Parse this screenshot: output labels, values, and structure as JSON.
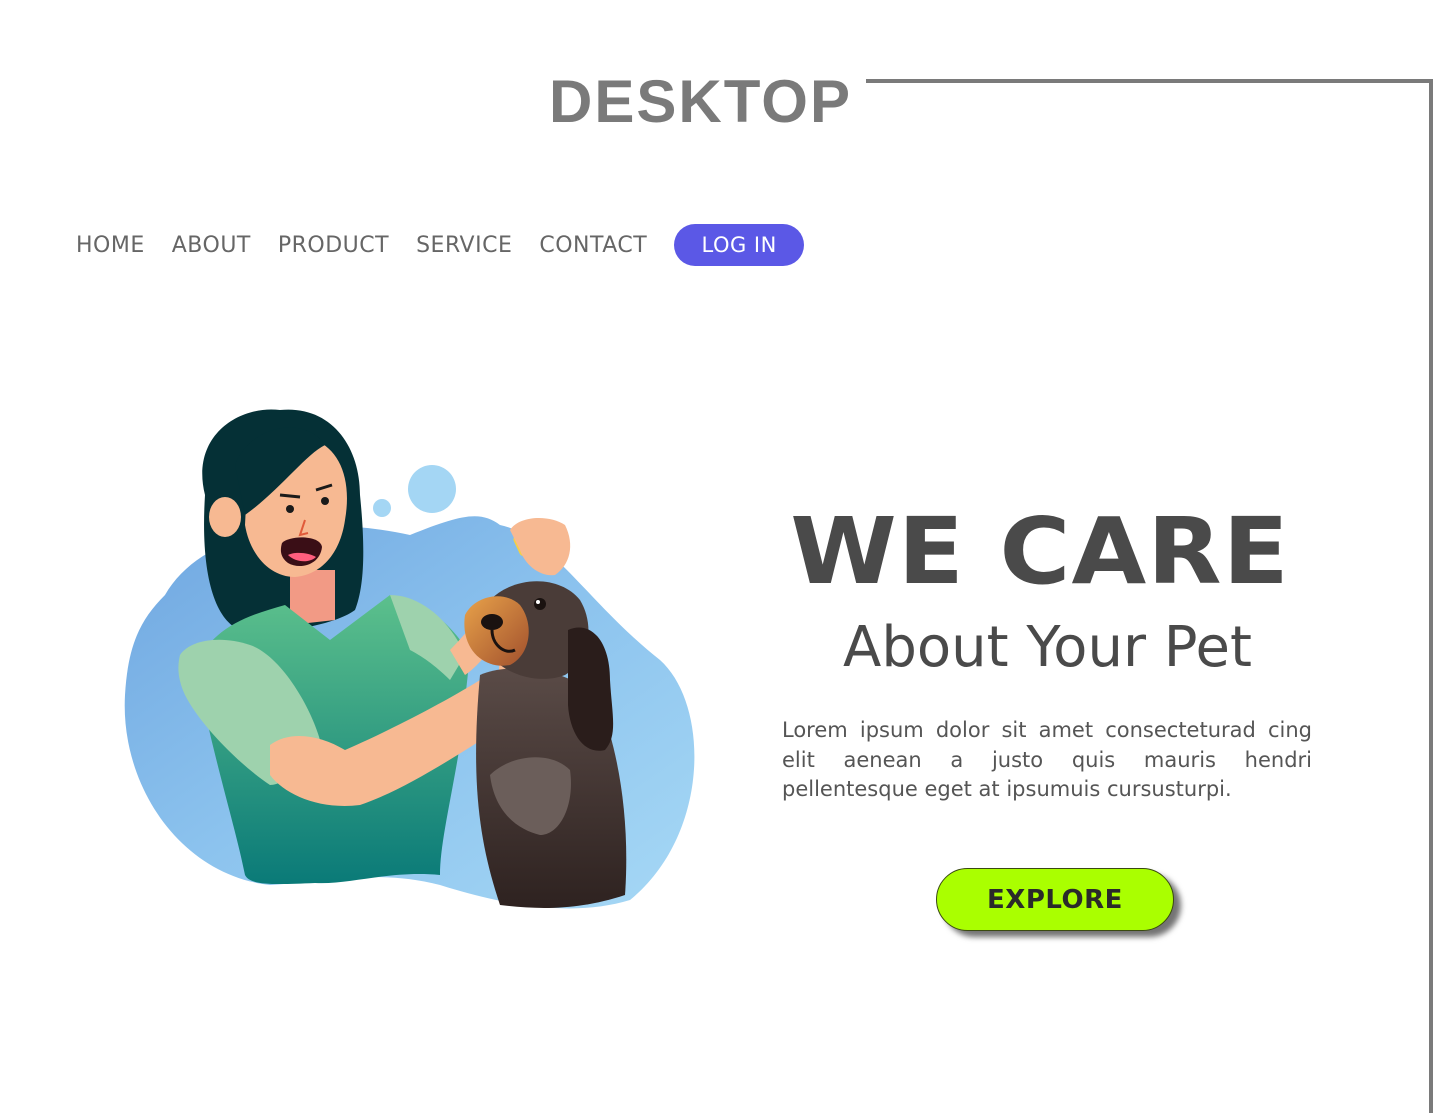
{
  "page_label": "DESKTOP",
  "nav": {
    "items": [
      {
        "label": "HOME"
      },
      {
        "label": "ABOUT"
      },
      {
        "label": "PRODUCT"
      },
      {
        "label": "SERVICE"
      },
      {
        "label": "CONTACT"
      }
    ],
    "login_label": "LOG IN"
  },
  "hero": {
    "title": "WE CARE",
    "subtitle": "About Your Pet",
    "body": "Lorem ipsum dolor sit amet consecteturad cing elit aenean a justo quis mauris hendri pellentesque eget at ipsumuis cursusturpi.",
    "cta_label": "EXPLORE"
  },
  "colors": {
    "accent_login": "#5b58e6",
    "cta": "#aaff00",
    "heading": "#4a4a4a",
    "frame": "#7a7a7a"
  },
  "illustration": {
    "subject": "woman-giving-eye-drops-to-dog"
  }
}
